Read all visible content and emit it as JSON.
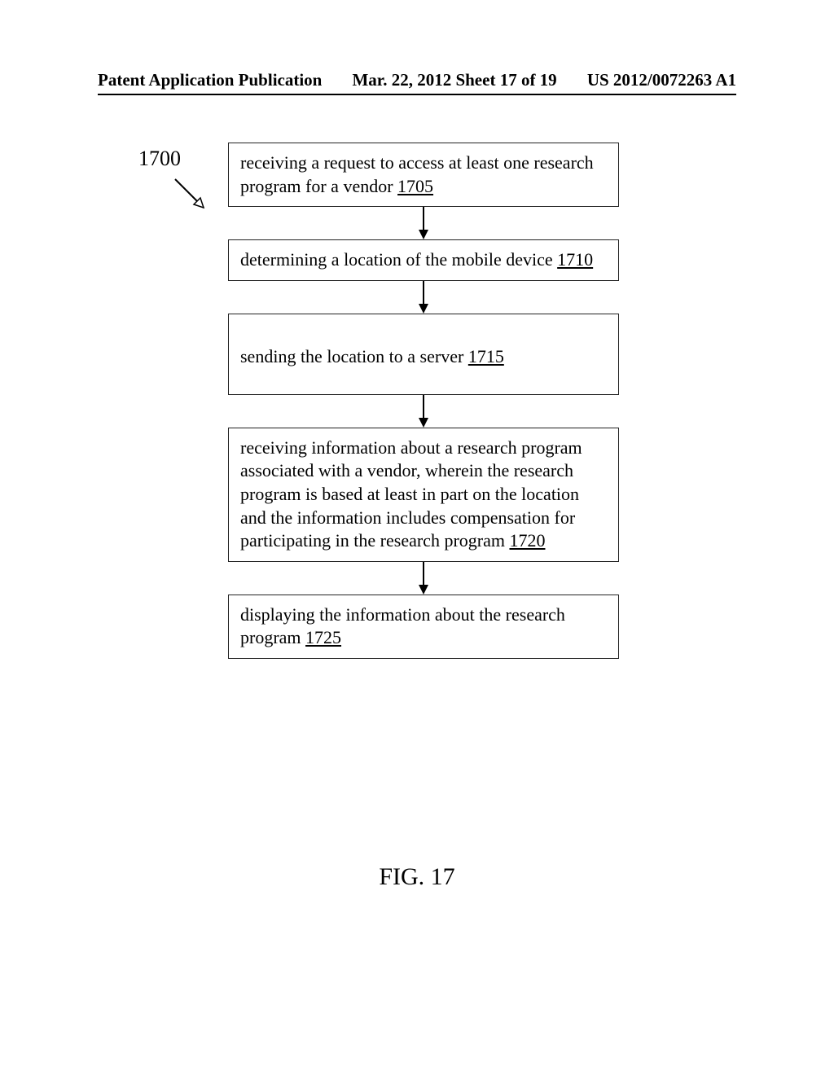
{
  "header": {
    "left": "Patent Application Publication",
    "center": "Mar. 22, 2012  Sheet 17 of 19",
    "right": "US 2012/0072263 A1"
  },
  "flowchart": {
    "ref_label": "1700",
    "boxes": [
      {
        "text": "receiving a request to access at least one research program for a vendor ",
        "num": "1705"
      },
      {
        "text": "determining a location of the mobile device ",
        "num": "1710"
      },
      {
        "text": "sending the location to a server ",
        "num": "1715"
      },
      {
        "text": "receiving information about a research program associated with a vendor, wherein the research program is based at least in part on the location and the information includes compensation for participating in the research program ",
        "num": "1720"
      },
      {
        "text": "displaying the information about the research program ",
        "num": "1725"
      }
    ]
  },
  "figure_caption": "FIG. 17"
}
